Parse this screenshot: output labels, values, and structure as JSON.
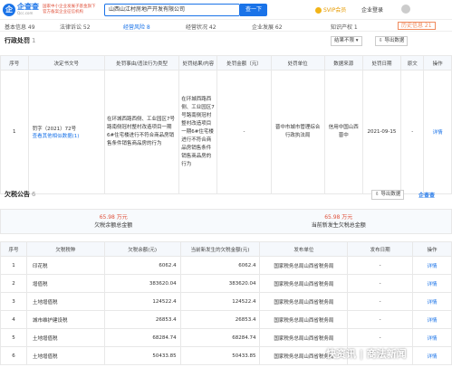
{
  "header": {
    "logo_icon": "企",
    "logo_text": "企查查",
    "logo_sub": "Qcc.com",
    "cert_line1": "国家中小企业发展子基金旗下",
    "cert_line2": "官方备案企业征信机构",
    "search_value": "山西山江村房地产开发有限公司",
    "search_button": "查一下",
    "svip": "SVIP会员",
    "login": "企业登录",
    "colors": {
      "accent": "#1a73e8",
      "red": "#e0533d"
    }
  },
  "nav": {
    "items": [
      "基本信息 49",
      "法律诉讼 52",
      "经营风险 8",
      "经营状况 42",
      "企业发展 62",
      "知识产权 1",
      "历史信息 21"
    ]
  },
  "penalty": {
    "title": "行政处罚",
    "count": "1",
    "filter_label": "结果不限",
    "export_label": "导出数据",
    "headers": [
      "序号",
      "决定书文号",
      "处罚事由/违法行为类型",
      "处罚结果/内容",
      "处罚金额（元）",
      "处罚单位",
      "数据来源",
      "处罚日期",
      "原文",
      "操作"
    ],
    "row": {
      "no": "1",
      "doc_no": "罚字（2021）72号",
      "doc_link": "查看其他相似数据(1)",
      "reason": "在环城西路西侧、工业园区7号路南侧冠村整村改造项目一期6#住宅楼进行不符合商品房销售条件销售商品房的行为",
      "result": "在环城西路西侧、工业园区7号路南侧冠村整村改造项目一期6#住宅楼进行不符合商品房销售条件销售商品房的行为",
      "amount": "-",
      "unit": "晋中市城市管理综合行政执法局",
      "source": "信用中国山西晋中",
      "date": "2021-09-15",
      "orig": "-",
      "op": "详情"
    }
  },
  "tax": {
    "title": "欠税公告",
    "count": "6",
    "export_label": "导出数据",
    "logo_text": "企查查",
    "sum1_value": "65.98",
    "sum1_unit": "万元",
    "sum1_label": "欠税余额总金额",
    "sum2_value": "65.98",
    "sum2_unit": "万元",
    "sum2_label": "当前新发生欠税总金额",
    "headers": [
      "序号",
      "欠税税种",
      "欠税余额(元)",
      "当前新发生的欠税金额(元)",
      "发布单位",
      "发布日期",
      "操作"
    ],
    "rows": [
      {
        "no": "1",
        "type": "印花税",
        "bal": "6062.4",
        "cur": "6062.4",
        "org": "国家税务总局山西省税务局",
        "date": "-",
        "op": "详情"
      },
      {
        "no": "2",
        "type": "增值税",
        "bal": "383620.04",
        "cur": "383620.04",
        "org": "国家税务总局山西省税务局",
        "date": "-",
        "op": "详情"
      },
      {
        "no": "3",
        "type": "土地增值税",
        "bal": "124522.4",
        "cur": "124522.4",
        "org": "国家税务总局山西省税务局",
        "date": "-",
        "op": "详情"
      },
      {
        "no": "4",
        "type": "城市维护建设税",
        "bal": "26853.4",
        "cur": "26853.4",
        "org": "国家税务总局山西省税务局",
        "date": "-",
        "op": "详情"
      },
      {
        "no": "5",
        "type": "土地增值税",
        "bal": "68284.74",
        "cur": "68284.74",
        "org": "国家税务总局山西省税务局",
        "date": "-",
        "op": "详情"
      },
      {
        "no": "6",
        "type": "土地增值税",
        "bal": "50433.85",
        "cur": "50433.85",
        "org": "国家税务总局山西省税务局",
        "date": "-",
        "op": "详情"
      }
    ]
  },
  "watermark": "快资讯 | 商法新闻"
}
